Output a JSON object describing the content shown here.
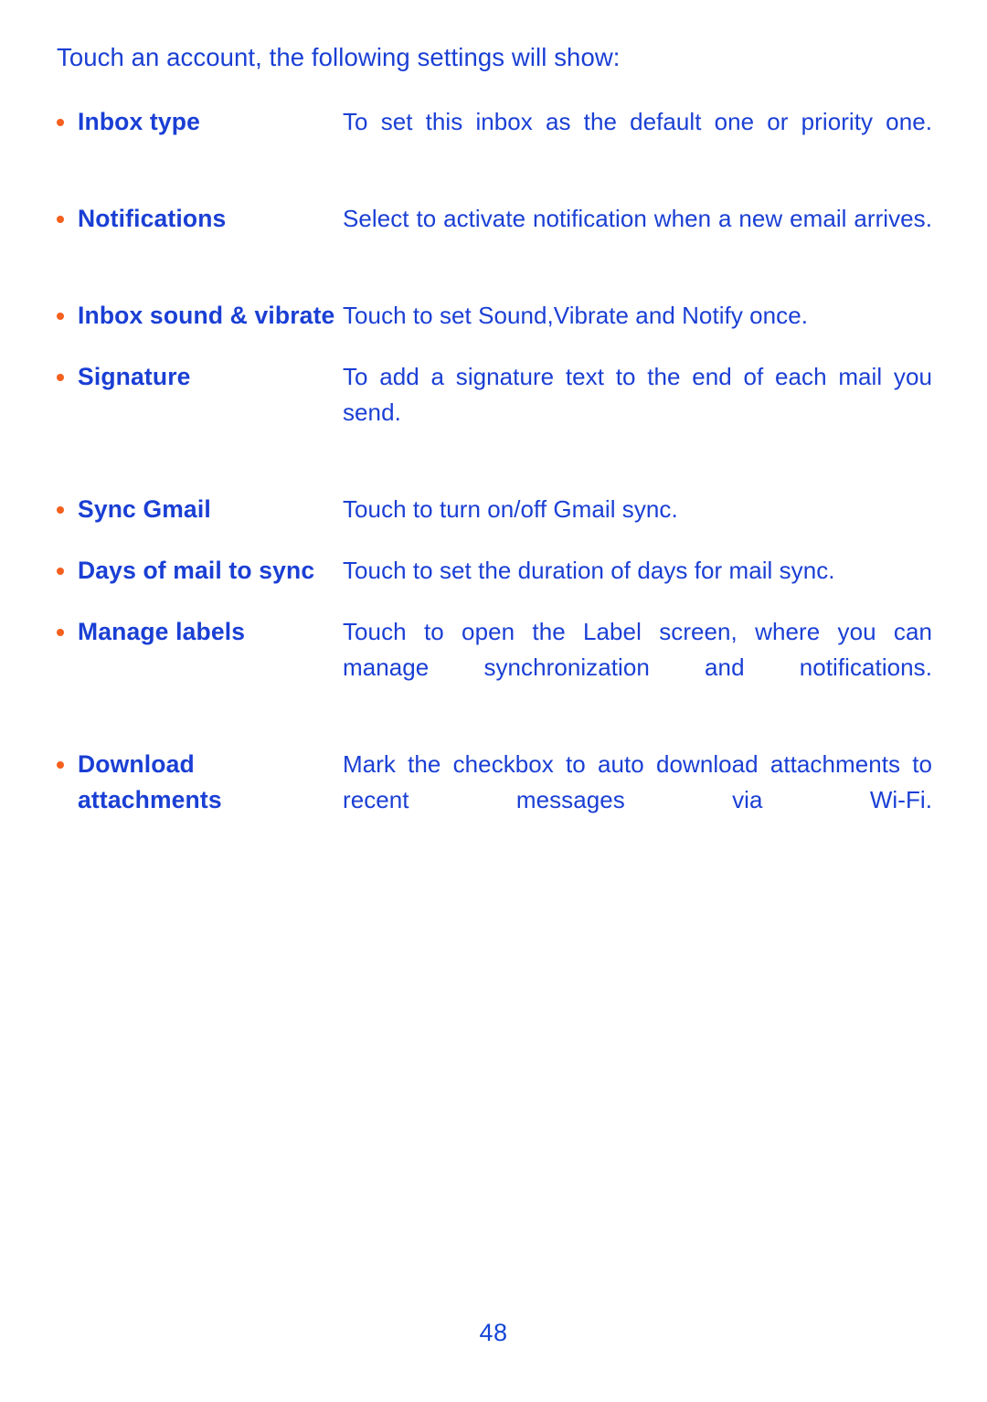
{
  "document": {
    "intro": "Touch an account, the following settings will show:",
    "page_number": "48",
    "accent_blue": "#1a3fd4",
    "bullet_orange": "#f4601e",
    "rows": [
      {
        "term": "Inbox type",
        "description": "To set this inbox as the default one or priority one."
      },
      {
        "term": "Notifications",
        "description": "Select to activate notification when a new email arrives."
      },
      {
        "term": "Inbox sound & vibrate",
        "description": "Touch to set Sound,Vibrate and Notify once."
      },
      {
        "term": "Signature",
        "description": "To add a signature text to the end of each mail you send."
      },
      {
        "term": "Sync Gmail",
        "description": "Touch to turn on/off Gmail sync."
      },
      {
        "term": "Days of mail to sync",
        "description": "Touch to set the duration of days for mail sync."
      },
      {
        "term": "Manage labels",
        "description": "Touch to open the Label screen, where you can manage synchronization and notifications."
      },
      {
        "term": "Download attachments",
        "description": "Mark the checkbox to auto download attachments to recent messages via Wi-Fi."
      }
    ]
  }
}
